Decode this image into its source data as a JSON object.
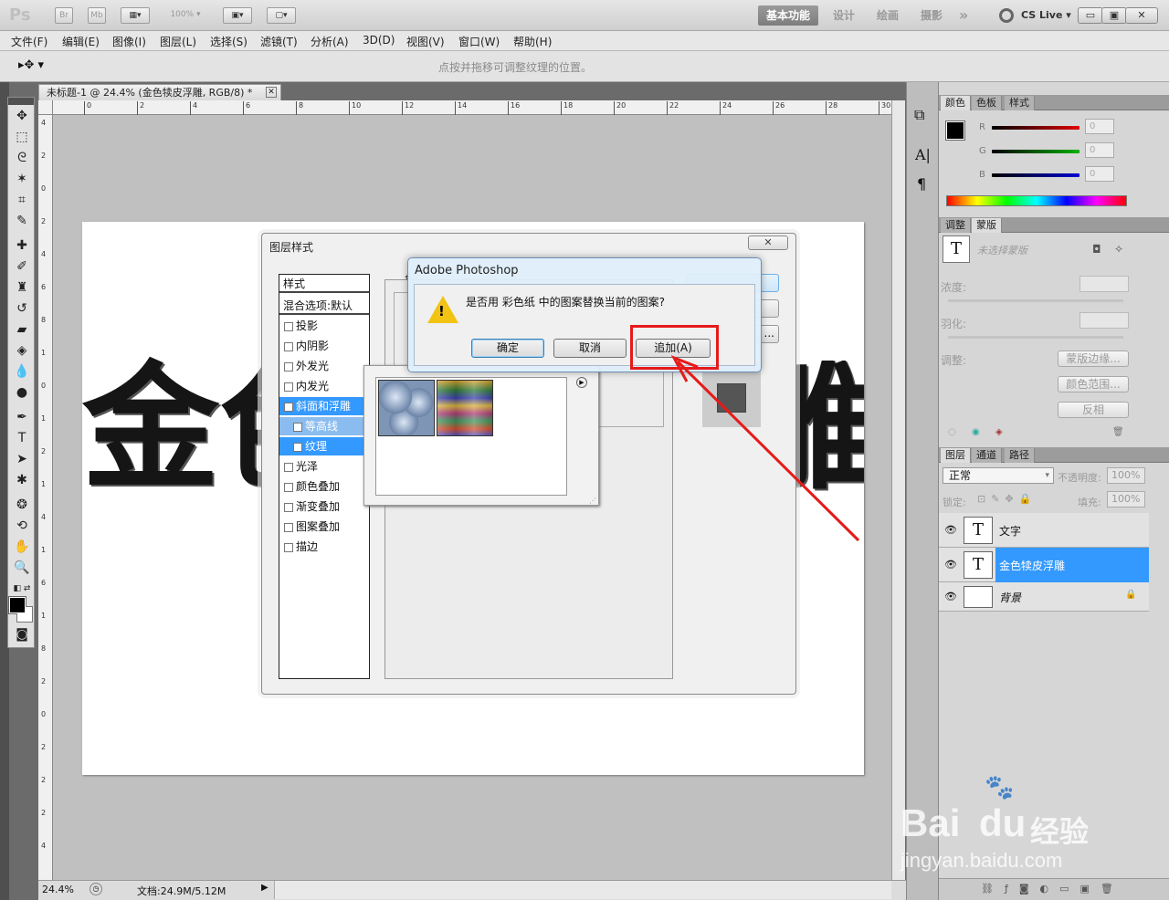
{
  "app": {
    "logo": "Ps",
    "br": "Br",
    "mb": "Mb",
    "zoom_preset": "100%",
    "workspaces": [
      "基本功能",
      "设计",
      "绘画",
      "摄影"
    ],
    "more": "»",
    "cslive": "CS Live"
  },
  "window_controls": {
    "minimize": "▭",
    "restore": "▣",
    "close": "✕"
  },
  "menus": [
    "文件(F)",
    "编辑(E)",
    "图像(I)",
    "图层(L)",
    "选择(S)",
    "滤镜(T)",
    "分析(A)",
    "3D(D)",
    "视图(V)",
    "窗口(W)",
    "帮助(H)"
  ],
  "options_hint": "点按并拖移可调整纹理的位置。",
  "document": {
    "tab_title": "未标题-1 @ 24.4% (金色犊皮浮雕, RGB/8) *",
    "canvas_text_left": "金色",
    "canvas_text_right": "雕",
    "zoom": "24.4%",
    "doc_size": "文档:24.9M/5.12M"
  },
  "ruler_h": [
    "0",
    "2",
    "4",
    "6",
    "8",
    "10",
    "12",
    "14",
    "16",
    "18",
    "20",
    "22",
    "24",
    "26",
    "28",
    "30"
  ],
  "ruler_v": [
    "4",
    "2",
    "0",
    "2",
    "4",
    "6",
    "8",
    "1",
    "0",
    "1",
    "2",
    "1",
    "4",
    "1",
    "6",
    "1",
    "8",
    "2",
    "0",
    "2",
    "2",
    "2",
    "4"
  ],
  "color_panel": {
    "tabs": [
      "颜色",
      "色板",
      "样式"
    ],
    "r_label": "R",
    "g_label": "G",
    "b_label": "B",
    "r": "0",
    "g": "0",
    "b": "0",
    "colors": {
      "r": "#e00000",
      "g": "#00b000",
      "b": "#0000d0"
    }
  },
  "masks_panel": {
    "tabs": [
      "调整",
      "蒙版"
    ],
    "mask_label": "未选择蒙版",
    "density": "浓度:",
    "feather": "羽化:",
    "refine": "调整:",
    "btn_edge": "蒙版边缘...",
    "btn_color": "颜色范围...",
    "btn_invert": "反相"
  },
  "layers_panel": {
    "tabs": [
      "图层",
      "通道",
      "路径"
    ],
    "blend": "正常",
    "opacity_label": "不透明度:",
    "opacity": "100%",
    "lock_label": "锁定:",
    "fill_label": "填充:",
    "fill": "100%",
    "layers": [
      {
        "name": "文字",
        "thumb": "T",
        "selected": false
      },
      {
        "name": "金色犊皮浮雕",
        "thumb": "T",
        "selected": true
      },
      {
        "name": "背景",
        "thumb": "",
        "selected": false,
        "locked": true
      }
    ]
  },
  "layer_style_dialog": {
    "title": "图层样式",
    "close": "✕",
    "styles_header": "样式",
    "blend_options": "混合选项:默认",
    "items": [
      {
        "label": "投影",
        "checked": false
      },
      {
        "label": "内阴影",
        "checked": false
      },
      {
        "label": "外发光",
        "checked": false
      },
      {
        "label": "内发光",
        "checked": false
      },
      {
        "label": "斜面和浮雕",
        "checked": true,
        "selected": true
      },
      {
        "label": "等高线",
        "checked": false,
        "sub": true,
        "selected": true
      },
      {
        "label": "纹理",
        "checked": true,
        "sub": true,
        "selected": true
      },
      {
        "label": "光泽",
        "checked": false
      },
      {
        "label": "颜色叠加",
        "checked": false
      },
      {
        "label": "渐变叠加",
        "checked": false
      },
      {
        "label": "图案叠加",
        "checked": false
      },
      {
        "label": "描边",
        "checked": false
      }
    ],
    "more_btn": "...",
    "section_partial": "纟"
  },
  "alert": {
    "title": "Adobe Photoshop",
    "message": "是否用 彩色纸 中的图案替换当前的图案?",
    "ok": "确定",
    "cancel": "取消",
    "append": "追加(A)"
  },
  "watermark": {
    "brand": "Bai",
    "mid": "du",
    "suffix": "经验",
    "url": "jingyan.baidu.com"
  }
}
